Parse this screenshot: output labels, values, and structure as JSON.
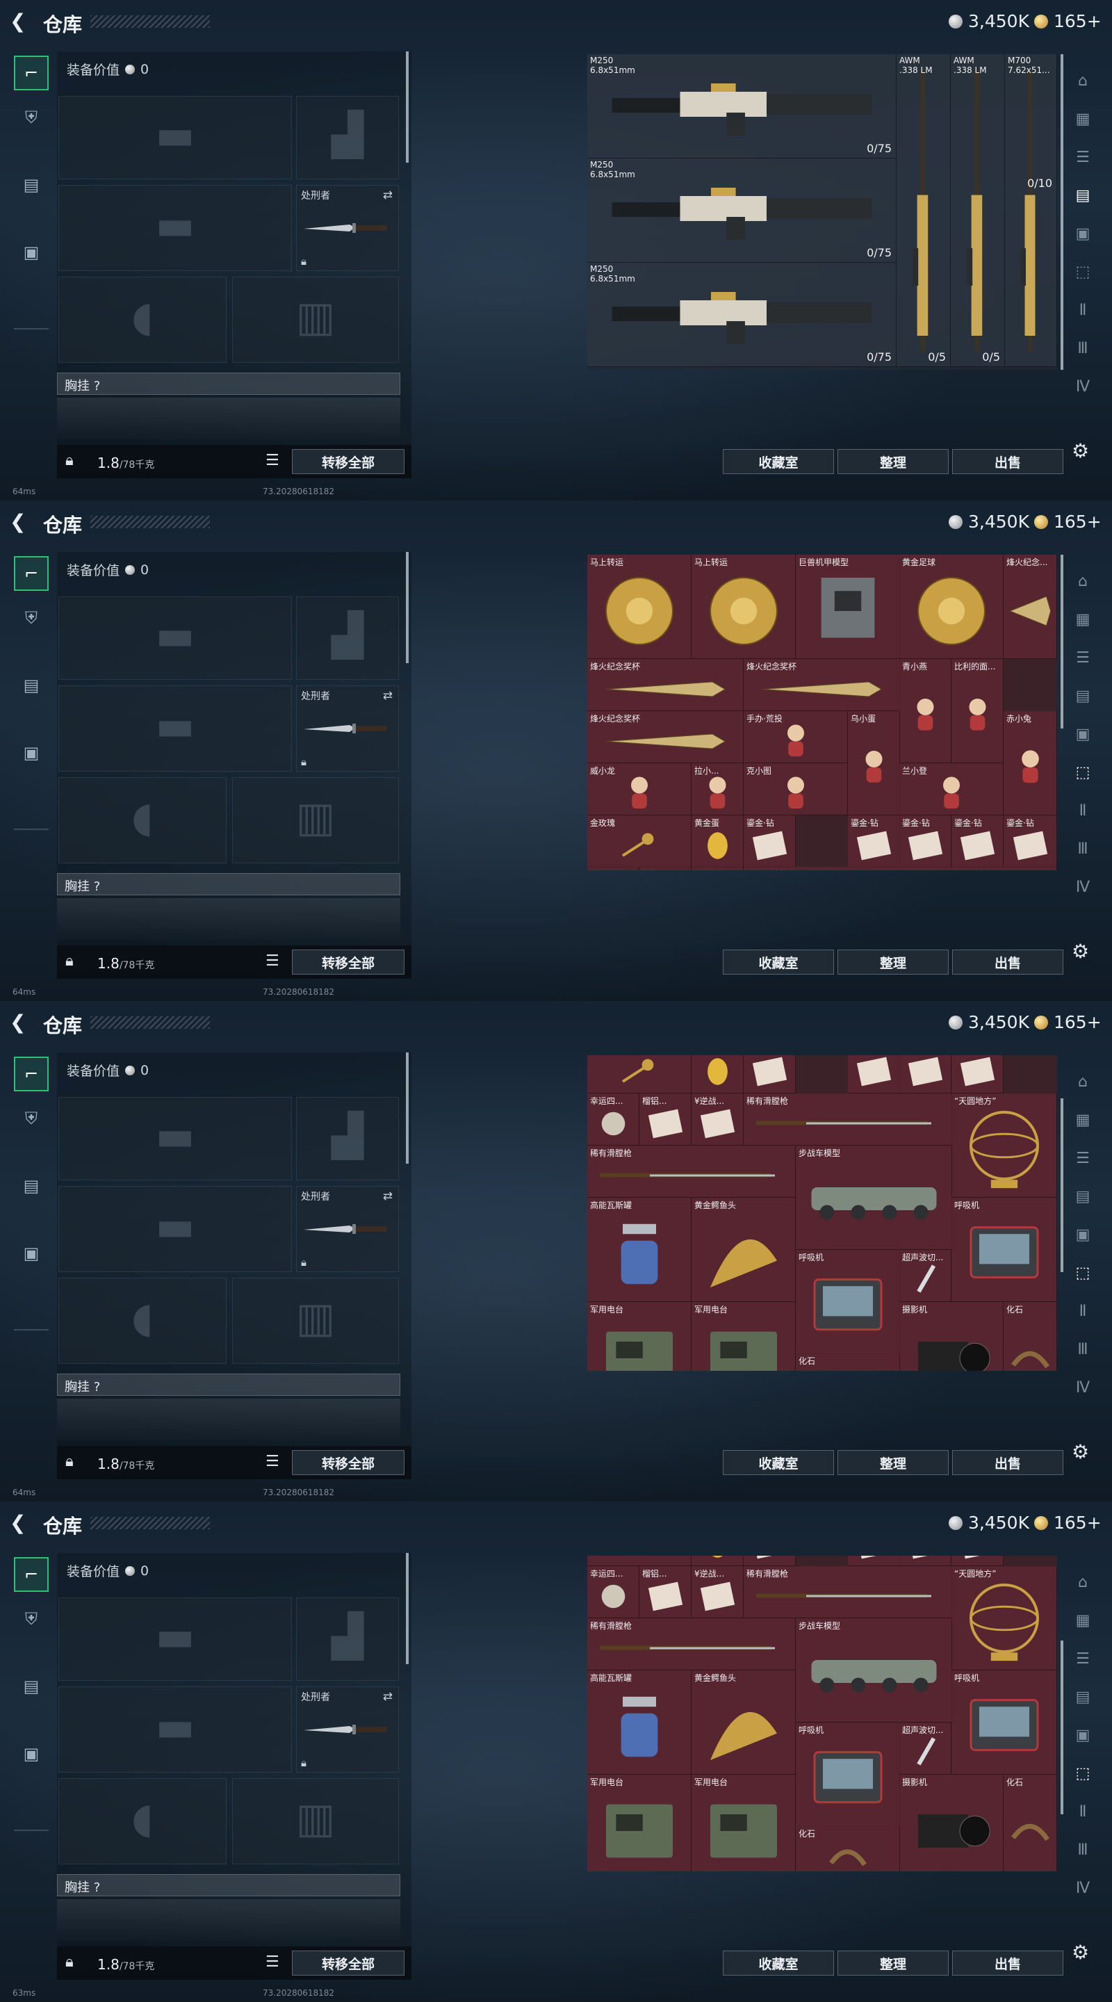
{
  "header": {
    "title": "仓库",
    "silver_amount": "3,450K",
    "gold_amount": "165+"
  },
  "equipment": {
    "value_label": "装备价值",
    "value": "0",
    "knife_label": "处刑者",
    "chest_label": "胸挂 ?",
    "weight_current": "1.8",
    "weight_max": "/78千克",
    "transfer_all": "转移全部"
  },
  "buttons": {
    "collection": "收藏室",
    "sort": "整理",
    "sell": "出售"
  },
  "status": [
    {
      "ping": "64ms",
      "build": "73.20280618182"
    },
    {
      "ping": "64ms",
      "build": "73.20280618182"
    },
    {
      "ping": "64ms",
      "build": "73.20280618182"
    },
    {
      "ping": "63ms",
      "build": "73.20280618182"
    }
  ],
  "weapons": [
    {
      "name": "M250",
      "caliber": "6.8x51mm",
      "ammo": "0/75"
    },
    {
      "name": "M250",
      "caliber": "6.8x51mm",
      "ammo": "0/75"
    },
    {
      "name": "M250",
      "caliber": "6.8x51mm",
      "ammo": "0/75"
    },
    {
      "name": "AWM",
      "caliber": ".338 LM",
      "ammo": "0/5"
    },
    {
      "name": "AWM",
      "caliber": ".338 LM",
      "ammo": "0/5"
    },
    {
      "name": "M700",
      "caliber": "7.62x51...",
      "ammo": "0/10"
    }
  ],
  "collectibles_page1": [
    "马上转运",
    "马上转运",
    "巨兽机甲模型",
    "黄金足球",
    "烽火纪念...",
    "烽火纪念奖杯",
    "烽火纪念奖杯",
    "青小燕",
    "比利的面...",
    "烽火纪念奖杯",
    "手办·荒投",
    "乌小蛋",
    "赤小兔",
    "威小龙",
    "拉小...",
    "克小图",
    "兰小登",
    "金玫瑰",
    "黄金蛋",
    "鎏金·钻",
    "鎏金·钻",
    "鎏金·钻",
    "鎏金·钻",
    "鎏金·钻",
    "幸运四...",
    "榴铝...",
    "¥逆战...",
    "稀有滑膛枪",
    "“天圆地方”",
    "稀有滑膛枪",
    "步战车模型"
  ],
  "collectibles_page2": [
    "金玫瑰",
    "黄金蛋",
    "鎏金·钻",
    "鎏金·钻",
    "鎏金·钻",
    "鎏金·钻",
    "幸运四...",
    "榴铝...",
    "¥逆战...",
    "稀有滑膛枪",
    "“天圆地方”",
    "稀有滑膛枪",
    "步战车模型",
    "高能瓦斯罐",
    "黄金鳄鱼头",
    "呼吸机",
    "呼吸机",
    "超声波切...",
    "军用电台",
    "军用电台",
    "摄影机",
    "化石",
    "化石"
  ]
}
